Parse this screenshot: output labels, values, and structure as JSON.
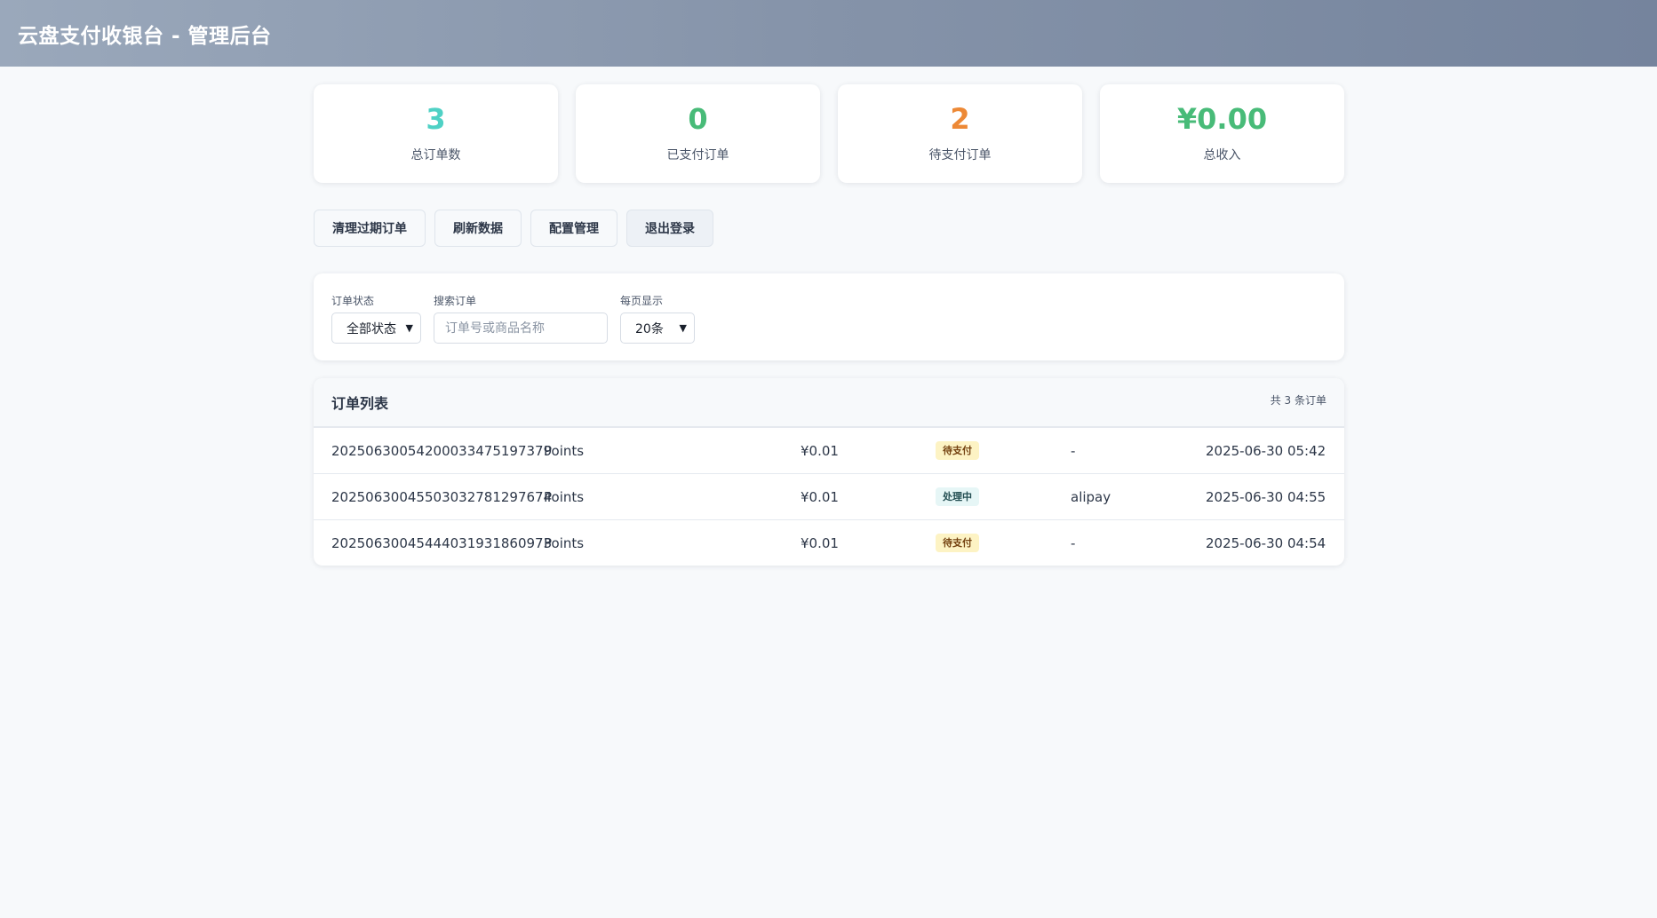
{
  "header": {
    "title": "云盘支付收银台 - 管理后台"
  },
  "stats": [
    {
      "value": "3",
      "label": "总订单数",
      "color": "#4fd1c5"
    },
    {
      "value": "0",
      "label": "已支付订单",
      "color": "#48bb78"
    },
    {
      "value": "2",
      "label": "待支付订单",
      "color": "#ed8936"
    },
    {
      "value": "¥0.00",
      "label": "总收入",
      "color": "#48bb78"
    }
  ],
  "actions": {
    "cleanup": "清理过期订单",
    "refresh": "刷新数据",
    "config": "配置管理",
    "logout": "退出登录"
  },
  "filters": {
    "status_label": "订单状态",
    "status_value": "全部状态",
    "search_label": "搜索订单",
    "search_placeholder": "订单号或商品名称",
    "search_value": "",
    "page_size_label": "每页显示",
    "page_size_value": "20条"
  },
  "orders": {
    "title": "订单列表",
    "count_text": "共 3 条订单",
    "rows": [
      {
        "id": "20250630054200033475197379",
        "name": "Points",
        "amount": "¥0.01",
        "status": "待支付",
        "status_type": "pending",
        "method": "-",
        "time": "2025-06-30 05:42"
      },
      {
        "id": "20250630045503032781297674",
        "name": "Points",
        "amount": "¥0.01",
        "status": "处理中",
        "status_type": "processing",
        "method": "alipay",
        "time": "2025-06-30 04:55"
      },
      {
        "id": "20250630045444031931860973",
        "name": "Points",
        "amount": "¥0.01",
        "status": "待支付",
        "status_type": "pending",
        "method": "-",
        "time": "2025-06-30 04:54"
      }
    ]
  }
}
